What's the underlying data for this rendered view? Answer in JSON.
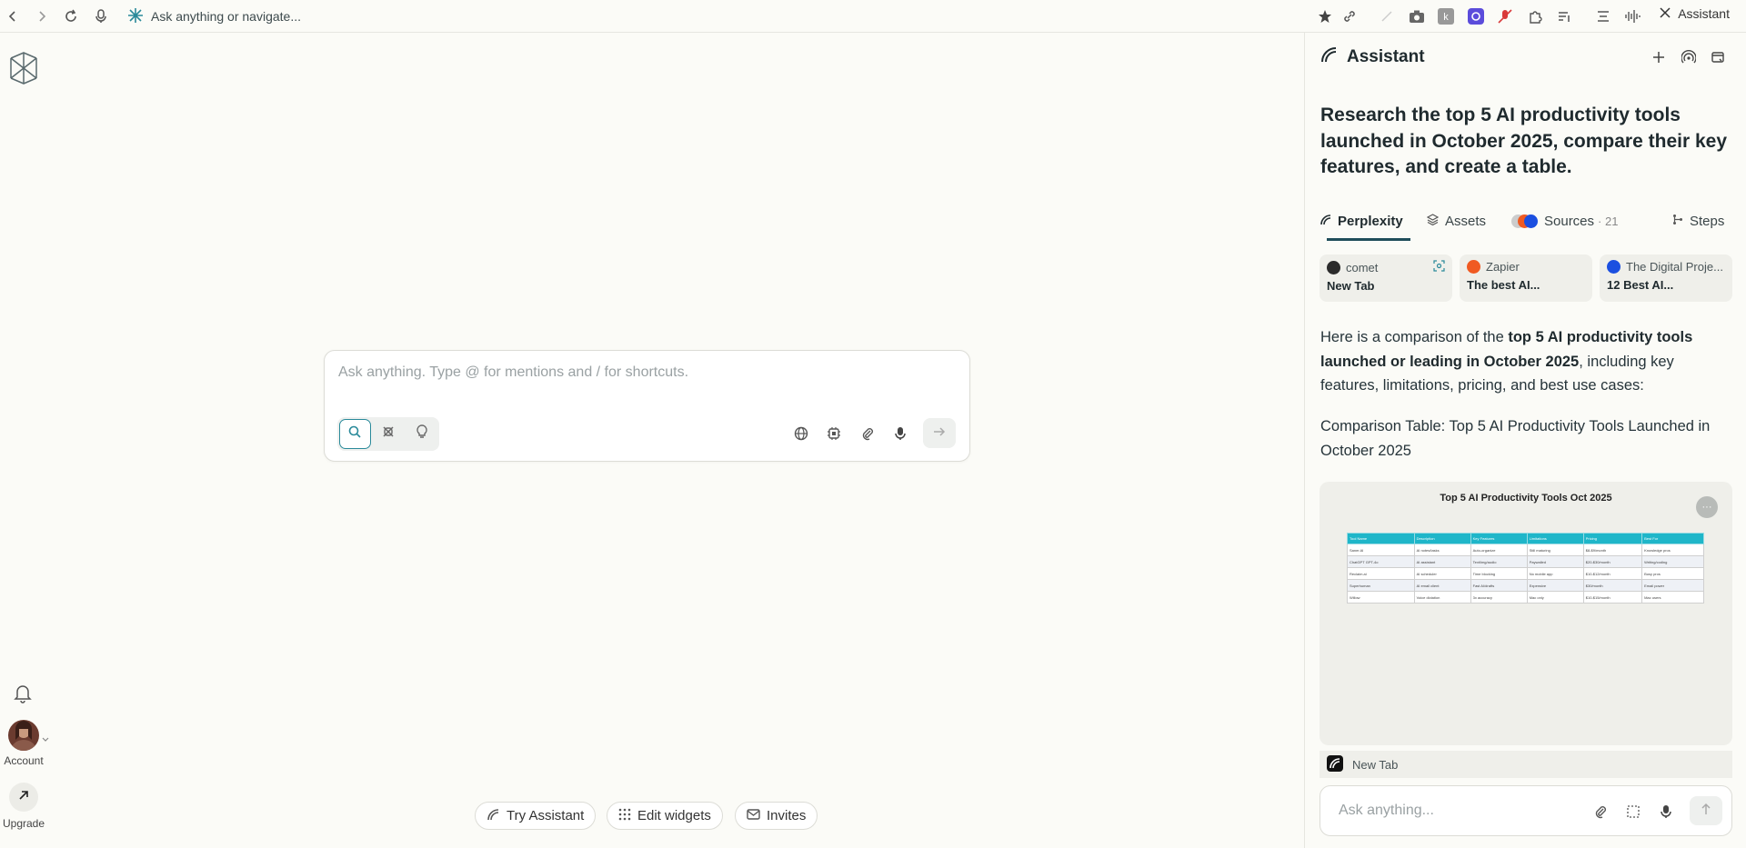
{
  "browser": {
    "omnibox_placeholder": "Ask anything or navigate...",
    "assistant_toggle_label": "Assistant"
  },
  "rail": {
    "account_label": "Account",
    "upgrade_label": "Upgrade"
  },
  "center": {
    "input_placeholder": "Ask anything. Type @ for mentions and / for shortcuts."
  },
  "bottom_pills": {
    "try_assistant": "Try Assistant",
    "edit_widgets": "Edit widgets",
    "invites": "Invites"
  },
  "assistant": {
    "title": "Assistant",
    "query": "Research the top 5 AI productivity tools launched in October 2025, compare their key features, and create a table.",
    "tabs": {
      "perplexity": "Perplexity",
      "assets": "Assets",
      "sources": "Sources",
      "sources_count": "· 21",
      "steps": "Steps"
    },
    "source_cards": [
      {
        "site": "comet",
        "title": "New Tab"
      },
      {
        "site": "Zapier",
        "title": "The best AI..."
      },
      {
        "site": "The Digital Proje...",
        "title": "12 Best AI..."
      }
    ],
    "answer": {
      "intro_pre": "Here is a comparison of the ",
      "intro_bold": "top 5 AI productivity tools launched or leading in October 2025",
      "intro_post": ", including key features, limitations, pricing, and best use cases:",
      "subheading": "Comparison Table: Top 5 AI Productivity Tools Launched in October 2025"
    },
    "image_card": {
      "title": "Top 5 AI Productivity Tools Oct 2025",
      "table_headers": [
        "Tool Name",
        "Description",
        "Key Features",
        "Limitations",
        "Pricing",
        "Best For"
      ],
      "table_rows": [
        [
          "Saner.AI",
          "AI notes/tasks",
          "Auto-organize",
          "Still maturing",
          "$8-$9/month",
          "Knowledge pros"
        ],
        [
          "ChatGPT GPT-4o",
          "AI assistant",
          "Text/img/audio",
          "Paywalled",
          "$20-$30/month",
          "Writing/coding"
        ],
        [
          "Reclaim.ai",
          "AI scheduler",
          "Time blocking",
          "No mobile app",
          "$10-$12/month",
          "Busy pros"
        ],
        [
          "Superhuman",
          "AI email client",
          "Fast AI/drafts",
          "Expensive",
          "$30/month",
          "Email power"
        ],
        [
          "Willow",
          "Voice dictation",
          "3x accuracy",
          "Mac only",
          "$10-$15/month",
          "Mac users"
        ]
      ]
    },
    "newtab_label": "New Tab",
    "bottom_placeholder": "Ask anything..."
  }
}
